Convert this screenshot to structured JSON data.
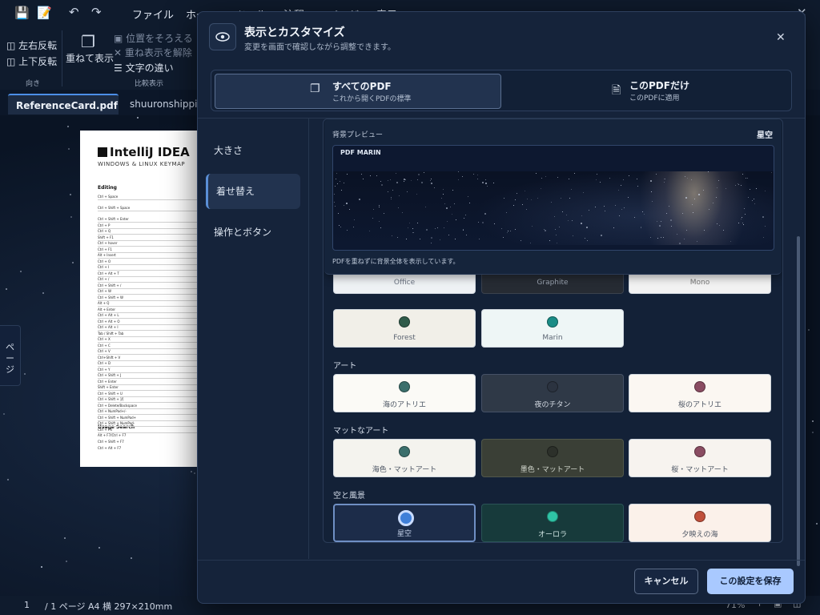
{
  "menubar": {
    "file": "ファイル",
    "home": "ホー",
    "tools": "ツール",
    "annot": "注釈",
    "page": "ページ",
    "view": "表示"
  },
  "ribbon": {
    "flip_h": "左右反転",
    "flip_v": "上下反転",
    "orient_cap": "向き",
    "overlay": "重ねて表示",
    "align_pos": "位置をそろえる",
    "remove_overlay": "重ね表示を解除",
    "text_diff": "文字の違い",
    "compare_cap": "比較表示"
  },
  "tabs": {
    "active": "ReferenceCard.pdf",
    "second": "shuuronshippitu"
  },
  "document": {
    "logo": "IntelliJ IDEA",
    "subtitle": "WINDOWS & LINUX KEYMAP",
    "section1": "Editing",
    "section2": "Usage Search",
    "rows": [
      "Ctrl + Space",
      "Ctrl + Shift + Space",
      "Ctrl + Shift + Enter",
      "Ctrl + P",
      "Ctrl + Q",
      "Shift + F1",
      "Ctrl + hover",
      "Ctrl + F1",
      "Alt + Insert",
      "Ctrl + O",
      "Ctrl + I",
      "Ctrl + Alt + T",
      "Ctrl + /",
      "Ctrl + Shift + /",
      "Ctrl + W",
      "Ctrl + Shift + W",
      "Alt + Q",
      "Alt + Enter",
      "Ctrl + Alt + L",
      "Ctrl + Alt + O",
      "Ctrl + Alt + I",
      "Tab / Shift + Tab",
      "Ctrl + X",
      "Ctrl + C",
      "Ctrl + V",
      "Ctrl+Shift + V",
      "Ctrl + D",
      "Ctrl + Y",
      "Ctrl + Shift + J",
      "Ctrl + Enter",
      "Shift + Enter",
      "Ctrl + Shift + U",
      "Ctrl + Shift + ]/[",
      "Ctrl + Delete/Backspace",
      "Ctrl + NumPad+/-",
      "Ctrl + Shift + NumPad+",
      "Ctrl + Shift + NumPad-",
      "Ctrl + F4"
    ],
    "search_rows": [
      "Alt + F7/Ctrl + F7",
      "Ctrl + Shift + F7",
      "Ctrl + Alt + F7"
    ]
  },
  "page_handle": "ページ",
  "statusbar": {
    "page_num": "1",
    "page_total": "/ 1 ページ",
    "paper": "A4 横 297×210mm",
    "zoom": "71%"
  },
  "dialog": {
    "title": "表示とカスタマイズ",
    "subtitle": "変更を画面で確認しながら調整できます。",
    "scope": {
      "all_title": "すべてのPDF",
      "all_sub": "これから開くPDFの標準",
      "this_title": "このPDFだけ",
      "this_sub": "このPDFに適用"
    },
    "nav": [
      "大きさ",
      "着せ替え",
      "操作とボタン"
    ],
    "preview": {
      "label": "背景プレビュー",
      "current": "星空",
      "doc_label": "PDF MARIN",
      "note": "PDFを重ねずに背景全体を表示しています。"
    },
    "sections": {
      "art": "アート",
      "matte": "マットなアート",
      "sky": "空と風景"
    },
    "themes_top": [
      "Office",
      "Graphite",
      "Mono"
    ],
    "themes_basic": [
      "Forest",
      "Marin"
    ],
    "themes_art": [
      "海のアトリエ",
      "夜のチタン",
      "桜のアトリエ"
    ],
    "themes_matte": [
      "海色・マットアート",
      "墨色・マットアート",
      "桜・マットアート"
    ],
    "themes_sky": [
      "星空",
      "オーロラ",
      "夕映えの海"
    ],
    "cancel": "キャンセル",
    "save": "この設定を保存"
  },
  "colors": {
    "accent": "#5b8fd6",
    "save_bg": "#a9c9ff",
    "forest": "#2f5b4a",
    "marin": "#1a8c86",
    "art_sea": "#3b6f6c",
    "art_titan": "#2b3340",
    "art_sakura": "#8a4c62",
    "sky_star": "#3f7fd8",
    "sky_aurora": "#2fc3a6",
    "sky_sunset": "#c0503b"
  }
}
